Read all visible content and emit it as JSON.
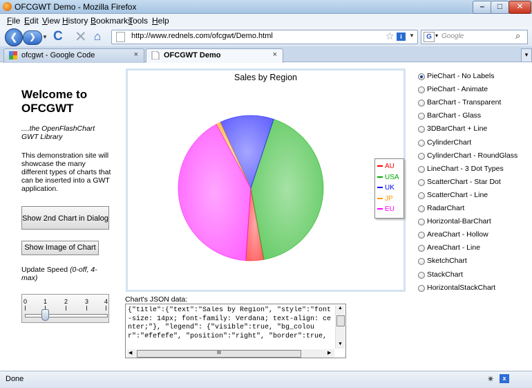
{
  "window": {
    "title": "OFCGWT Demo - Mozilla Firefox",
    "minimize": "–",
    "maximize": "□",
    "close": "✕"
  },
  "menu": [
    "File",
    "Edit",
    "View",
    "History",
    "Bookmarks",
    "Tools",
    "Help"
  ],
  "nav": {
    "back": "❮",
    "forward": "❯",
    "reload": "C",
    "stop": "✕",
    "home": "⌂",
    "url": "http://www.rednels.com/ofcgwt/Demo.html",
    "search_placeholder": "Google",
    "search_engine_letter": "G"
  },
  "tabs": [
    {
      "label": "ofcgwt - Google Code",
      "close": "×",
      "active": false
    },
    {
      "label": "OFCGWT Demo",
      "close": "×",
      "active": true
    }
  ],
  "sidebar": {
    "welcome": "Welcome to OFCGWT",
    "subtitle": "....the OpenFlashChart GWT Library",
    "description": "This demonstration site will showcase the many different types of charts that can be inserted into a GWT application.",
    "btn_dialog": "Show 2nd Chart in Dialog",
    "btn_image": "Show Image of Chart",
    "speed_label": "Update Speed",
    "speed_hint": "(0-off, 4-max)",
    "slider_ticks": [
      "0",
      "1",
      "2",
      "3",
      "4"
    ],
    "slider_value": 1
  },
  "chart_data": {
    "type": "pie",
    "title": "Sales by Region",
    "labels": [
      "AU",
      "USA",
      "UK",
      "JP",
      "EU"
    ],
    "values": [
      4,
      42,
      12,
      1,
      41
    ],
    "colors": [
      "#ff0000",
      "#00aa00",
      "#0000ff",
      "#ff9900",
      "#ff00ff"
    ],
    "legend": "right",
    "show_labels": false
  },
  "json_panel": {
    "label": "Chart's JSON data:",
    "text": "{\"title\":{\"text\":\"Sales by Region\", \"style\":\"font-size: 14px; font-family: Verdana; text-align: center;\"}, \"legend\": {\"visible\":true, \"bg_colour\":\"#fefefe\", \"position\":\"right\", \"border\":true,"
  },
  "chart_types": [
    {
      "label": "PieChart - No Labels",
      "selected": true
    },
    {
      "label": "PieChart - Animate",
      "selected": false
    },
    {
      "label": "BarChart - Transparent",
      "selected": false
    },
    {
      "label": "BarChart - Glass",
      "selected": false
    },
    {
      "label": "3DBarChart + Line",
      "selected": false
    },
    {
      "label": "CylinderChart",
      "selected": false
    },
    {
      "label": "CylinderChart - RoundGlass",
      "selected": false
    },
    {
      "label": "LineChart - 3 Dot Types",
      "selected": false
    },
    {
      "label": "ScatterChart - Star Dot",
      "selected": false
    },
    {
      "label": "ScatterChart - Line",
      "selected": false
    },
    {
      "label": "RadarChart",
      "selected": false
    },
    {
      "label": "Horizontal-BarChart",
      "selected": false
    },
    {
      "label": "AreaChart - Hollow",
      "selected": false
    },
    {
      "label": "AreaChart - Line",
      "selected": false
    },
    {
      "label": "SketchChart",
      "selected": false
    },
    {
      "label": "StackChart",
      "selected": false
    },
    {
      "label": "HorizontalStackChart",
      "selected": false
    }
  ],
  "status": {
    "text": "Done"
  }
}
